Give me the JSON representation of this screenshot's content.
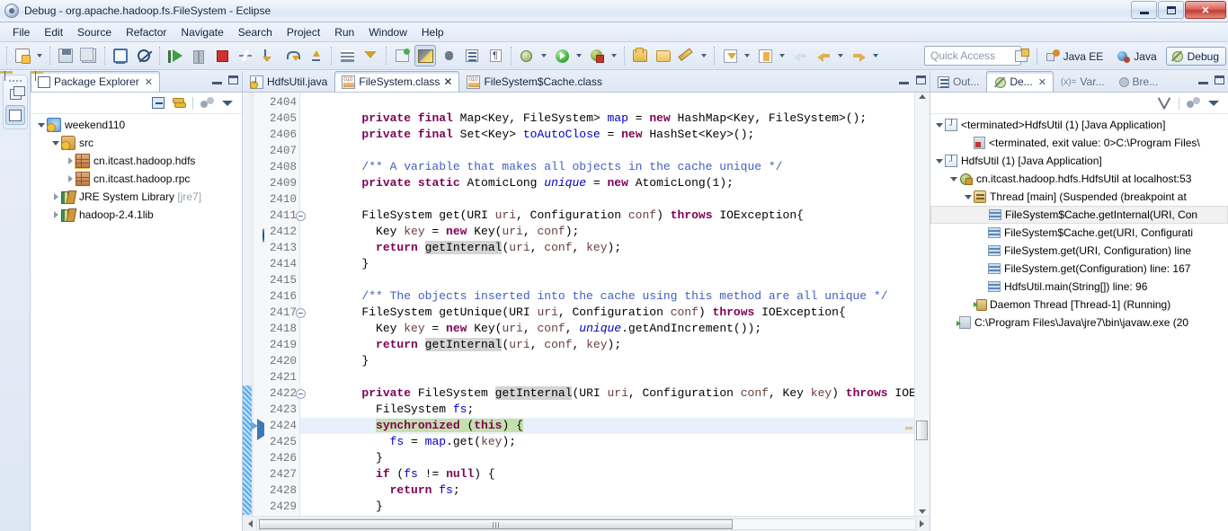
{
  "window": {
    "title": "Debug - org.apache.hadoop.fs.FileSystem - Eclipse",
    "app_icon": "eclipse-icon",
    "minimize_label": "Minimize",
    "restore_label": "Restore",
    "close_label": "Close"
  },
  "menubar": {
    "items": [
      {
        "label": "File"
      },
      {
        "label": "Edit"
      },
      {
        "label": "Source"
      },
      {
        "label": "Refactor"
      },
      {
        "label": "Navigate"
      },
      {
        "label": "Search"
      },
      {
        "label": "Project"
      },
      {
        "label": "Run"
      },
      {
        "label": "Window"
      },
      {
        "label": "Help"
      }
    ]
  },
  "toolbar": {
    "buttons": [
      {
        "name": "new-wizard",
        "icon": "new-file-icon"
      },
      {
        "name": "new-wizard-dropdown",
        "icon": "chevron-down-icon"
      },
      {
        "name": "save",
        "icon": "save-icon"
      },
      {
        "name": "save-all",
        "icon": "save-all-icon"
      },
      {
        "name": "open-console",
        "icon": "console-icon"
      },
      {
        "name": "skip-all-breakpoints",
        "icon": "skip-breakpoints-icon"
      },
      {
        "name": "resume",
        "icon": "resume-icon"
      },
      {
        "name": "suspend",
        "icon": "suspend-icon"
      },
      {
        "name": "terminate",
        "icon": "terminate-icon"
      },
      {
        "name": "disconnect",
        "icon": "disconnect-icon"
      },
      {
        "name": "step-into",
        "icon": "step-into-icon"
      },
      {
        "name": "step-over",
        "icon": "step-over-icon"
      },
      {
        "name": "step-return",
        "icon": "step-return-icon"
      },
      {
        "name": "drop-to-frame",
        "icon": "list-icon"
      },
      {
        "name": "use-step-filters",
        "icon": "filter-icon"
      },
      {
        "name": "new-java-class",
        "icon": "new-class-icon"
      },
      {
        "name": "debug-perspective-toggle",
        "icon": "debug-perspective-icon"
      },
      {
        "name": "new-annotation",
        "icon": "annotation-icon"
      },
      {
        "name": "open-type",
        "icon": "open-type-icon"
      },
      {
        "name": "toggle-mark-occurrences",
        "icon": "pilcrow-icon"
      },
      {
        "name": "debug-last",
        "icon": "bug-icon"
      },
      {
        "name": "debug-last-dropdown",
        "icon": "chevron-down-icon"
      },
      {
        "name": "run-last",
        "icon": "run-icon"
      },
      {
        "name": "run-last-dropdown",
        "icon": "chevron-down-icon"
      },
      {
        "name": "external-tools",
        "icon": "external-tools-icon"
      },
      {
        "name": "external-tools-dropdown",
        "icon": "chevron-down-icon"
      },
      {
        "name": "search",
        "icon": "search-folder-icon"
      },
      {
        "name": "open-task",
        "icon": "open-folder-icon"
      },
      {
        "name": "last-edit-location",
        "icon": "pencil-icon"
      },
      {
        "name": "last-edit-dropdown",
        "icon": "chevron-down-icon"
      },
      {
        "name": "next-annotation",
        "icon": "next-annotation-icon"
      },
      {
        "name": "next-annotation-dropdown",
        "icon": "chevron-down-icon"
      },
      {
        "name": "previous-annotation",
        "icon": "previous-annotation-icon"
      },
      {
        "name": "previous-annotation-dropdown",
        "icon": "chevron-down-icon"
      },
      {
        "name": "back",
        "icon": "back-arrow-icon"
      },
      {
        "name": "back-pale",
        "icon": "back-arrow-icon"
      },
      {
        "name": "back-dropdown",
        "icon": "chevron-down-icon"
      },
      {
        "name": "forward",
        "icon": "forward-arrow-icon"
      },
      {
        "name": "forward-dropdown",
        "icon": "chevron-down-icon"
      }
    ],
    "quick_access_placeholder": "Quick Access"
  },
  "perspectives": {
    "open_perspective_label": "Open Perspective",
    "items": [
      {
        "label": "Java EE",
        "icon": "java-ee-perspective-icon",
        "active": false
      },
      {
        "label": "Java",
        "icon": "java-perspective-icon",
        "active": false
      },
      {
        "label": "Debug",
        "icon": "debug-perspective-icon",
        "active": true
      }
    ]
  },
  "fastview": {
    "buttons": [
      {
        "name": "restore-view",
        "icon": "restore-icon"
      },
      {
        "name": "package-explorer-fastview",
        "icon": "package-explorer-icon"
      }
    ]
  },
  "package_explorer": {
    "tab_label": "Package Explorer",
    "close_glyph": "✕",
    "minimize_label": "Minimize",
    "maximize_label": "Maximize",
    "toolbar": [
      {
        "name": "collapse-all",
        "icon": "collapse-all-icon"
      },
      {
        "name": "link-with-editor",
        "icon": "link-editor-icon"
      },
      {
        "name": "focus-on-active-task",
        "icon": "focus-task-icon"
      },
      {
        "name": "view-menu",
        "icon": "view-menu-icon"
      }
    ],
    "tree": [
      {
        "label": "weekend110",
        "icon": "java-project-icon",
        "indent": 0,
        "expander": "expanded"
      },
      {
        "label": "src",
        "icon": "source-folder-icon",
        "indent": 1,
        "expander": "expanded"
      },
      {
        "label": "cn.itcast.hadoop.hdfs",
        "icon": "package-warning-icon",
        "indent": 2,
        "expander": "collapsed"
      },
      {
        "label": "cn.itcast.hadoop.rpc",
        "icon": "package-icon",
        "indent": 2,
        "expander": "collapsed"
      },
      {
        "label": "JRE System Library ",
        "suffix": "[jre7]",
        "icon": "library-icon",
        "indent": 1,
        "expander": "collapsed"
      },
      {
        "label": "hadoop-2.4.1lib",
        "icon": "library-icon",
        "indent": 1,
        "expander": "collapsed"
      }
    ]
  },
  "editor": {
    "tabs": [
      {
        "label": "HdfsUtil.java",
        "icon": "java-file-icon",
        "active": false,
        "closable": false
      },
      {
        "label": "FileSystem.class",
        "icon": "class-file-icon",
        "active": true,
        "closable": true,
        "close_glyph": "✕"
      },
      {
        "label": "FileSystem$Cache.class",
        "icon": "class-file-icon",
        "active": false,
        "closable": false
      }
    ],
    "minimize_label": "Minimize",
    "maximize_label": "Maximize",
    "first_line_number": 2404,
    "current_line_number": 2424,
    "lines": [
      {
        "n": 2404,
        "text": "",
        "fold": false,
        "marker": null,
        "changed": false
      },
      {
        "n": 2405,
        "text": "        private final Map<Key, FileSystem> map = new HashMap<Key, FileSystem>();",
        "fold": false,
        "marker": null,
        "changed": false
      },
      {
        "n": 2406,
        "text": "        private final Set<Key> toAutoClose = new HashSet<Key>();",
        "fold": false,
        "marker": null,
        "changed": false
      },
      {
        "n": 2407,
        "text": "",
        "fold": false,
        "marker": null,
        "changed": false
      },
      {
        "n": 2408,
        "text": "        /** A variable that makes all objects in the cache unique */",
        "fold": false,
        "marker": null,
        "changed": false
      },
      {
        "n": 2409,
        "text": "        private static AtomicLong unique = new AtomicLong(1);",
        "fold": false,
        "marker": null,
        "changed": false
      },
      {
        "n": 2410,
        "text": "",
        "fold": false,
        "marker": null,
        "changed": false
      },
      {
        "n": 2411,
        "text": "        FileSystem get(URI uri, Configuration conf) throws IOException{",
        "fold": true,
        "marker": null,
        "changed": false
      },
      {
        "n": 2412,
        "text": "          Key key = new Key(uri, conf);",
        "fold": false,
        "marker": "breakpoint",
        "changed": false
      },
      {
        "n": 2413,
        "text": "          return getInternal(uri, conf, key);",
        "fold": false,
        "marker": null,
        "changed": false
      },
      {
        "n": 2414,
        "text": "        }",
        "fold": false,
        "marker": null,
        "changed": false
      },
      {
        "n": 2415,
        "text": "",
        "fold": false,
        "marker": null,
        "changed": false
      },
      {
        "n": 2416,
        "text": "        /** The objects inserted into the cache using this method are all unique */",
        "fold": false,
        "marker": null,
        "changed": false
      },
      {
        "n": 2417,
        "text": "        FileSystem getUnique(URI uri, Configuration conf) throws IOException{",
        "fold": true,
        "marker": null,
        "changed": false
      },
      {
        "n": 2418,
        "text": "          Key key = new Key(uri, conf, unique.getAndIncrement());",
        "fold": false,
        "marker": null,
        "changed": false
      },
      {
        "n": 2419,
        "text": "          return getInternal(uri, conf, key);",
        "fold": false,
        "marker": null,
        "changed": false
      },
      {
        "n": 2420,
        "text": "        }",
        "fold": false,
        "marker": null,
        "changed": false
      },
      {
        "n": 2421,
        "text": "",
        "fold": false,
        "marker": null,
        "changed": false
      },
      {
        "n": 2422,
        "text": "        private FileSystem getInternal(URI uri, Configuration conf, Key key) throws IOE",
        "fold": true,
        "marker": null,
        "changed": true
      },
      {
        "n": 2423,
        "text": "          FileSystem fs;",
        "fold": false,
        "marker": null,
        "changed": true
      },
      {
        "n": 2424,
        "text": "          synchronized (this) {",
        "fold": false,
        "marker": "instruction-pointer",
        "changed": true
      },
      {
        "n": 2425,
        "text": "            fs = map.get(key);",
        "fold": false,
        "marker": null,
        "changed": true
      },
      {
        "n": 2426,
        "text": "          }",
        "fold": false,
        "marker": null,
        "changed": true
      },
      {
        "n": 2427,
        "text": "          if (fs != null) {",
        "fold": false,
        "marker": null,
        "changed": true
      },
      {
        "n": 2428,
        "text": "            return fs;",
        "fold": false,
        "marker": null,
        "changed": true
      },
      {
        "n": 2429,
        "text": "          }",
        "fold": false,
        "marker": null,
        "changed": true
      }
    ]
  },
  "debug_view": {
    "tabs": [
      {
        "label": "Out...",
        "icon": "outline-icon",
        "active": false,
        "closable": false
      },
      {
        "label": "De...",
        "icon": "debug-icon",
        "active": true,
        "closable": true,
        "close_glyph": "✕"
      },
      {
        "label": "Var...",
        "icon": "variables-icon",
        "active": false,
        "closable": false,
        "prefix": "(x)="
      },
      {
        "label": "Bre...",
        "icon": "breakpoints-icon",
        "active": false,
        "closable": false
      }
    ],
    "minimize_label": "Minimize",
    "maximize_label": "Maximize",
    "toolbar": [
      {
        "name": "remove-all-terminated",
        "icon": "remove-all-terminated-icon"
      },
      {
        "name": "show-thread-groups",
        "icon": "thread-groups-icon"
      },
      {
        "name": "view-menu",
        "icon": "view-menu-icon"
      }
    ],
    "tree": [
      {
        "label": "<terminated>HdfsUtil (1) [Java Application]",
        "icon": "launch-icon",
        "indent": 0,
        "expander": "expanded",
        "selected": false
      },
      {
        "label": "<terminated, exit value: 0>C:\\Program Files\\",
        "icon": "process-icon",
        "indent": 2,
        "expander": "none",
        "selected": false
      },
      {
        "label": "HdfsUtil (1) [Java Application]",
        "icon": "launch-icon",
        "indent": 0,
        "expander": "expanded",
        "selected": false
      },
      {
        "label": "cn.itcast.hadoop.hdfs.HdfsUtil at localhost:53",
        "icon": "debug-target-icon",
        "indent": 1,
        "expander": "expanded",
        "selected": false
      },
      {
        "label": "Thread [main] (Suspended (breakpoint at",
        "icon": "thread-icon",
        "indent": 2,
        "expander": "expanded",
        "selected": false
      },
      {
        "label": "FileSystem$Cache.getInternal(URI, Con",
        "icon": "stack-frame-icon",
        "indent": 3,
        "expander": "none",
        "selected": true
      },
      {
        "label": "FileSystem$Cache.get(URI, Configurati",
        "icon": "stack-frame-icon",
        "indent": 3,
        "expander": "none",
        "selected": false
      },
      {
        "label": "FileSystem.get(URI, Configuration) line",
        "icon": "stack-frame-icon",
        "indent": 3,
        "expander": "none",
        "selected": false
      },
      {
        "label": "FileSystem.get(Configuration) line: 167",
        "icon": "stack-frame-icon",
        "indent": 3,
        "expander": "none",
        "selected": false
      },
      {
        "label": "HdfsUtil.main(String[]) line: 96",
        "icon": "stack-frame-icon",
        "indent": 3,
        "expander": "none",
        "selected": false
      },
      {
        "label": "Daemon Thread [Thread-1] (Running)",
        "icon": "thread-running-icon",
        "indent": 2,
        "expander": "none",
        "selected": false
      },
      {
        "label": "C:\\Program Files\\Java\\jre7\\bin\\javaw.exe (20",
        "icon": "system-process-icon",
        "indent": 1,
        "expander": "none",
        "selected": false
      }
    ]
  },
  "scrollbars": {
    "vertical_up": "▲",
    "vertical_down": "▼",
    "horizontal_left": "◀",
    "horizontal_right": "▶"
  },
  "colors": {
    "keyword": "#7f0055",
    "comment": "#3f7f5f",
    "javadoc": "#3f5fbf",
    "field": "#0000c0",
    "parameter": "#6a3e3e",
    "current_line_highlight": "#e8f1fb",
    "debug_line_highlight": "#c5e0ae",
    "occurrence_highlight": "#d4d4d4",
    "selection": "#f1f1f1",
    "changed_line_marker": "#3aa0e8"
  }
}
